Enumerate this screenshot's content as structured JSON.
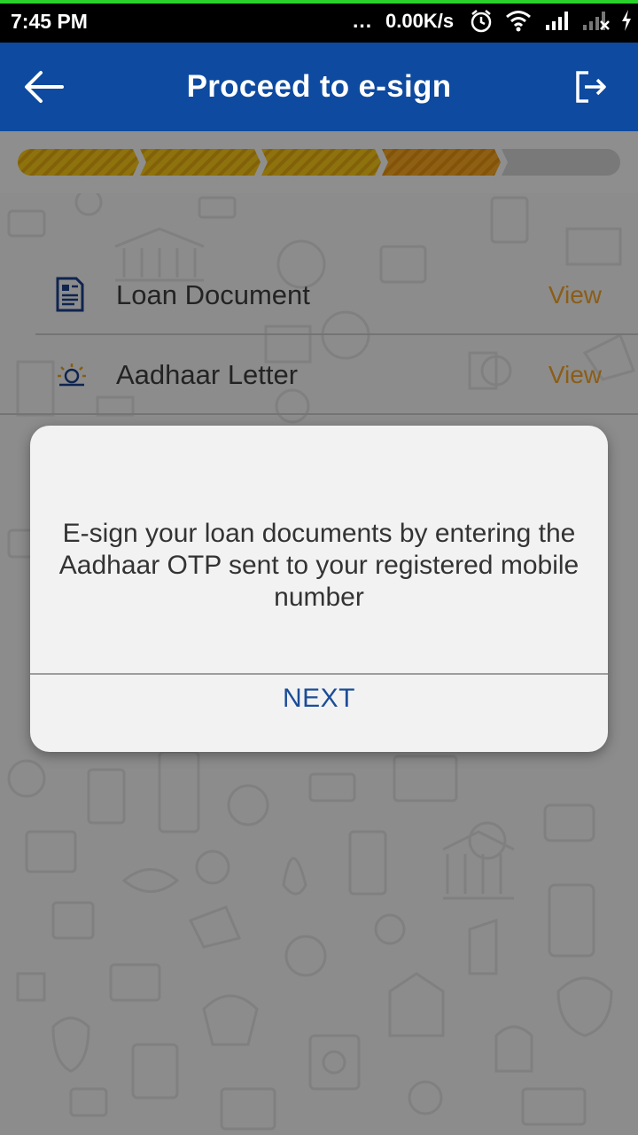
{
  "status_bar": {
    "time": "7:45 PM",
    "more": "...",
    "speed": "0.00K/s",
    "icons": [
      "alarm-icon",
      "wifi-icon",
      "signal-icon",
      "signal-no-service-icon",
      "charging-icon"
    ]
  },
  "app_bar": {
    "title": "Proceed to e-sign",
    "back_icon": "back-arrow-icon",
    "logout_icon": "logout-icon",
    "color": "#0d4aa0"
  },
  "progress": {
    "steps_total": 5,
    "steps_completed": 4,
    "completed_color": "#f5c518",
    "current_color": "#f5a623",
    "pending_color": "#d0d0d0"
  },
  "documents": [
    {
      "label": "Loan Document",
      "action": "View",
      "icon": "document-icon"
    },
    {
      "label": "Aadhaar Letter",
      "action": "View",
      "icon": "aadhaar-logo-icon"
    }
  ],
  "dialog": {
    "message": "E-sign your loan documents by entering the Aadhaar OTP sent to your registered mobile number",
    "next_label": "NEXT",
    "accent": "#1b4d97"
  }
}
